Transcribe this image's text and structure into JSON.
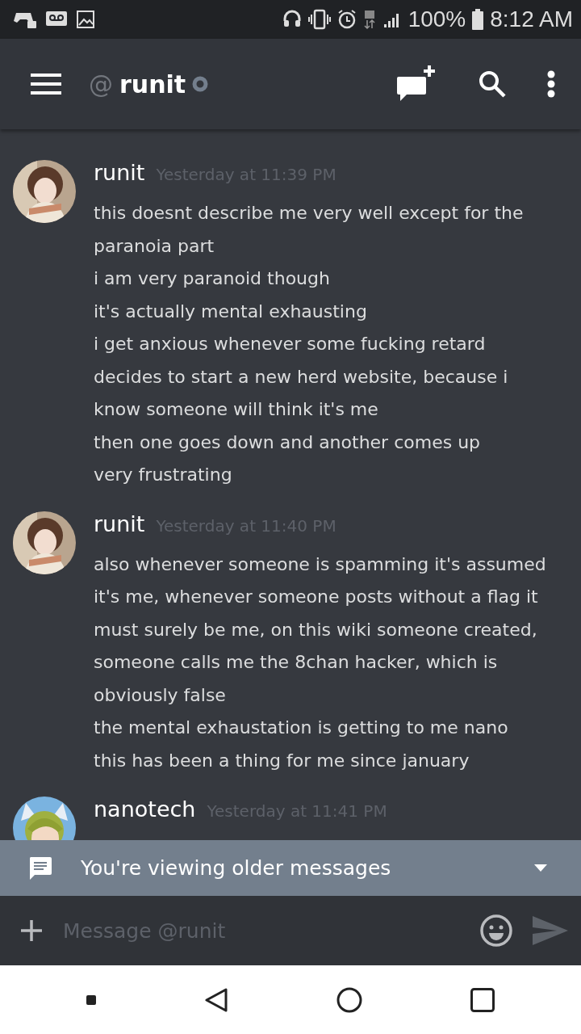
{
  "status_bar": {
    "battery": "100%",
    "time": "8:12 AM"
  },
  "header": {
    "prefix": "@",
    "title": "runit"
  },
  "messages": [
    {
      "author": "runit",
      "timestamp": "Yesterday at 11:39 PM",
      "lines": [
        "this doesnt describe me very well except for the paranoia part",
        "i am very paranoid though",
        "it's actually mental exhausting",
        "i get anxious whenever some fucking retard decides to start a new herd website, because i know someone will think it's me",
        "then one goes down and another comes up",
        "very frustrating"
      ]
    },
    {
      "author": "runit",
      "timestamp": "Yesterday at 11:40 PM",
      "lines": [
        "also whenever someone is spamming it's assumed it's me, whenever someone posts without a flag it must surely be me, on this wiki someone created, someone calls me the 8chan hacker, which is obviously false",
        "the mental exhaustation is getting to me nano",
        "this has been a thing for me since january"
      ]
    },
    {
      "author": "nanotech",
      "timestamp": "Yesterday at 11:41 PM"
    }
  ],
  "banner": {
    "text": "You're viewing older messages"
  },
  "composer": {
    "placeholder": "Message @runit"
  }
}
